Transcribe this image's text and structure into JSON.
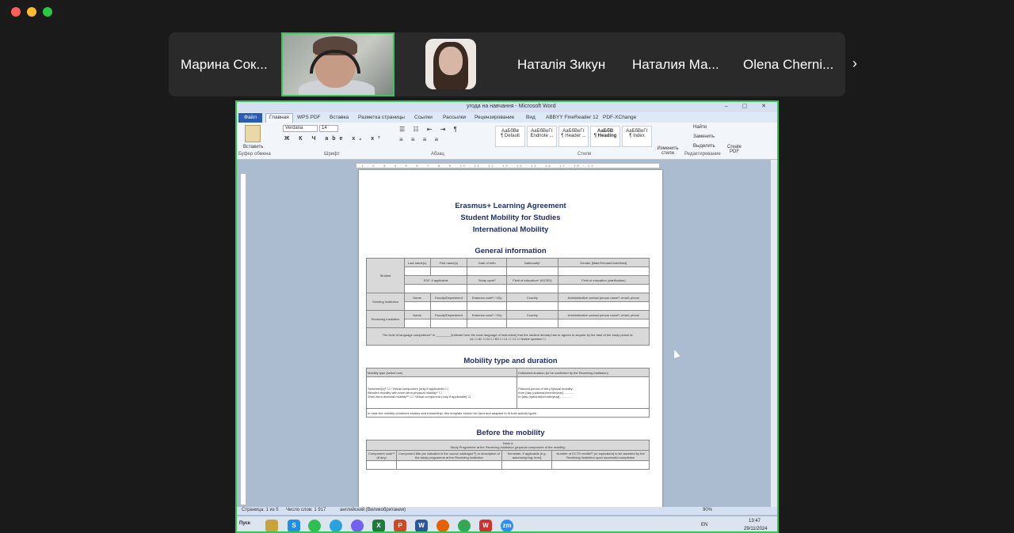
{
  "participants": {
    "p1": "Марина Сок...",
    "p2": "Наталія Зикун",
    "p3": "Наталия Ма...",
    "p4": "Olena Cherni..."
  },
  "word": {
    "title": "угода на навчання - Microsoft Word",
    "tabs": [
      "Файл",
      "Главная",
      "WPS PDF",
      "Вставка",
      "Разметка страницы",
      "Ссылки",
      "Рассылки",
      "Рецензирование",
      "Вид",
      "ABBYY FineReader 12",
      "PDF-XChange"
    ],
    "font_name": "Verdana",
    "font_size": "14",
    "paste_label": "Вставить",
    "group_labels": {
      "clipboard": "Буфер обмена",
      "font": "Шрифт",
      "paragraph": "Абзац",
      "styles": "Стили",
      "editing": "Редактирование"
    },
    "styles": [
      {
        "preview": "АаБбВв",
        "name": "¶ Default"
      },
      {
        "preview": "АаБбВеГг",
        "name": "Endnote ..."
      },
      {
        "preview": "АаБбВеГг",
        "name": "¶ Header ..."
      },
      {
        "preview": "АаБбВ",
        "name": "¶ Heading"
      },
      {
        "preview": "АаБбВеГг",
        "name": "¶ Index"
      }
    ],
    "change_styles": "Изменить стили",
    "find": "Найти",
    "replace": "Заменить",
    "select": "Выделить",
    "create_pdf": "Create PDF"
  },
  "document": {
    "heading1": "Erasmus+ Learning Agreement",
    "heading2": "Student Mobility for Studies",
    "heading3": "International Mobility",
    "general": "General information",
    "student_label": "Student",
    "cols1": [
      "Last name(s)",
      "First name(s)",
      "Date of birth",
      "Nationality¹",
      "Gender [Male/Female/Undefined]"
    ],
    "cols2": [
      "ESI², if applicable",
      "Study cycle³",
      "Field of education⁴ (ISCED)",
      "Field of education (clarification)"
    ],
    "inst_cols": [
      "Name",
      "Faculty/Department",
      "Erasmus code⁵ / City",
      "Country",
      "Administrative contact person name⁶; email; phone"
    ],
    "sending": "Sending Institution",
    "receiving": "Receiving Institution",
    "lang_note": "The level of language competence⁷ in ________ [indicate here the main language of instruction] that the student already has or agrees to acquire by the start of the study period is:",
    "levels": "A1 ☐   A2 ☐   B1 ☐   B2 ☐   C1 ☐   C2 ☐   Native speaker ☐",
    "mobility": "Mobility type and duration",
    "mob_type": "Mobility type (select one)",
    "mob_duration": "Estimated duration (to be confirmed by the Receiving Institution)",
    "mob_opts": [
      "Semester(s)⁸ ☐  /  Virtual component (only if applicable) ☐",
      "Blended mobility with short-term physical mobility⁹ ☐",
      "Short-term doctoral mobility¹⁰ ☐  /  Virtual component (only if applicable) ☐"
    ],
    "planned": "Planned period of the physical mobility:",
    "from": "from [day (optional)/month/year] ............",
    "to": "to [day (optional)/month/year] ............",
    "combine_note": "In case the mobility combines studies and traineeship, this template should be used and adapted to fit both activity types.",
    "before": "Before the mobility",
    "table_a": "Table A",
    "table_a_sub": "Study Programme at the Receiving Institution (physical component of the mobility)",
    "table_a_cols": [
      "Component code¹¹ (if any)",
      "Component title (as indicated in the course catalogue¹²) or description of the study programme at the Receiving Institution",
      "Semester, if applicable [e.g. autumn/spring; term]",
      "Number of ECTS credits¹³ (or equivalent) to be awarded by the Receiving Institution upon successful completion"
    ]
  },
  "status": {
    "page": "Страница: 1 из 5",
    "words": "Число слов: 1 917",
    "lang": "английский (Великобритания)",
    "zoom": "90%"
  },
  "taskbar": {
    "start": "Пуск",
    "lang": "EN",
    "time": "13:47",
    "date": "29/11/2024"
  }
}
